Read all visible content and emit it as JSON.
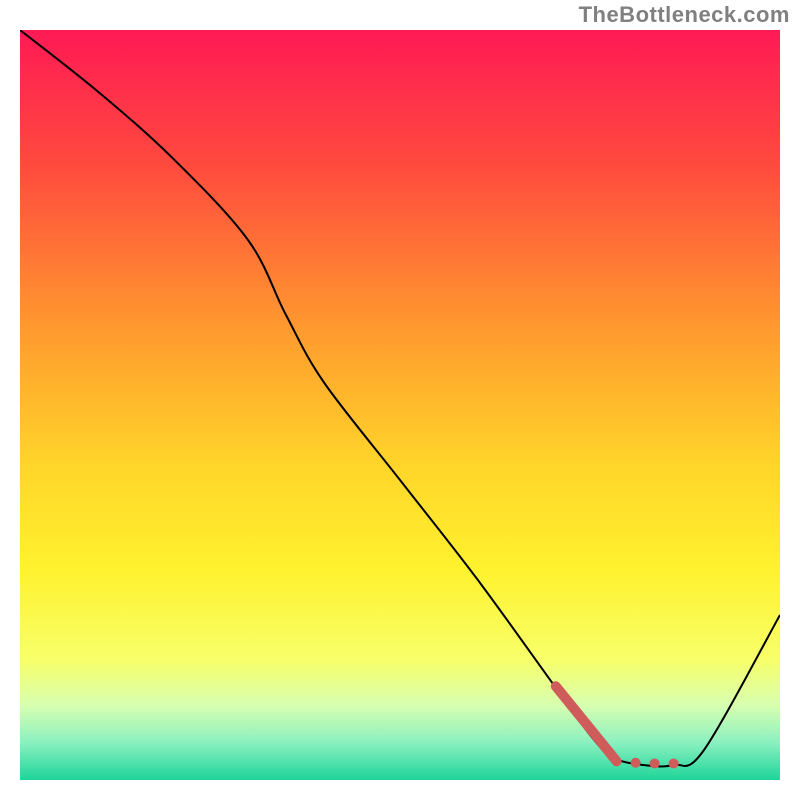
{
  "watermark": "TheBottleneck.com",
  "chart_data": {
    "type": "line",
    "title": "",
    "xlabel": "",
    "ylabel": "",
    "xlim": [
      0,
      100
    ],
    "ylim": [
      0,
      100
    ],
    "background": {
      "kind": "vertical-gradient",
      "stops": [
        {
          "pos": 0.0,
          "color": "#ff1a55"
        },
        {
          "pos": 0.18,
          "color": "#ff4a3e"
        },
        {
          "pos": 0.4,
          "color": "#ff9a2e"
        },
        {
          "pos": 0.58,
          "color": "#ffd52a"
        },
        {
          "pos": 0.72,
          "color": "#fff22e"
        },
        {
          "pos": 0.84,
          "color": "#f7ff6a"
        },
        {
          "pos": 0.9,
          "color": "#d8ffb0"
        },
        {
          "pos": 0.95,
          "color": "#8bf0c0"
        },
        {
          "pos": 1.0,
          "color": "#1dd59a"
        }
      ]
    },
    "series": [
      {
        "name": "curve",
        "color": "#000000",
        "width": 2,
        "x": [
          0,
          10,
          20,
          30,
          35,
          40,
          50,
          60,
          70,
          75,
          78,
          82,
          86,
          90,
          100
        ],
        "y": [
          100,
          92,
          83,
          72,
          62,
          53,
          40,
          27,
          13,
          6,
          3,
          2,
          2,
          4,
          22
        ]
      }
    ],
    "highlight": {
      "name": "optimal-region",
      "color": "#cf5b5b",
      "width": 10,
      "dot_radius": 5,
      "segment_x": [
        70.5,
        78.5
      ],
      "segment_y": [
        12.5,
        2.5
      ],
      "dots_x": [
        78.5,
        81,
        83.5,
        86
      ],
      "dots_y": [
        2.5,
        2.3,
        2.2,
        2.2
      ]
    }
  }
}
